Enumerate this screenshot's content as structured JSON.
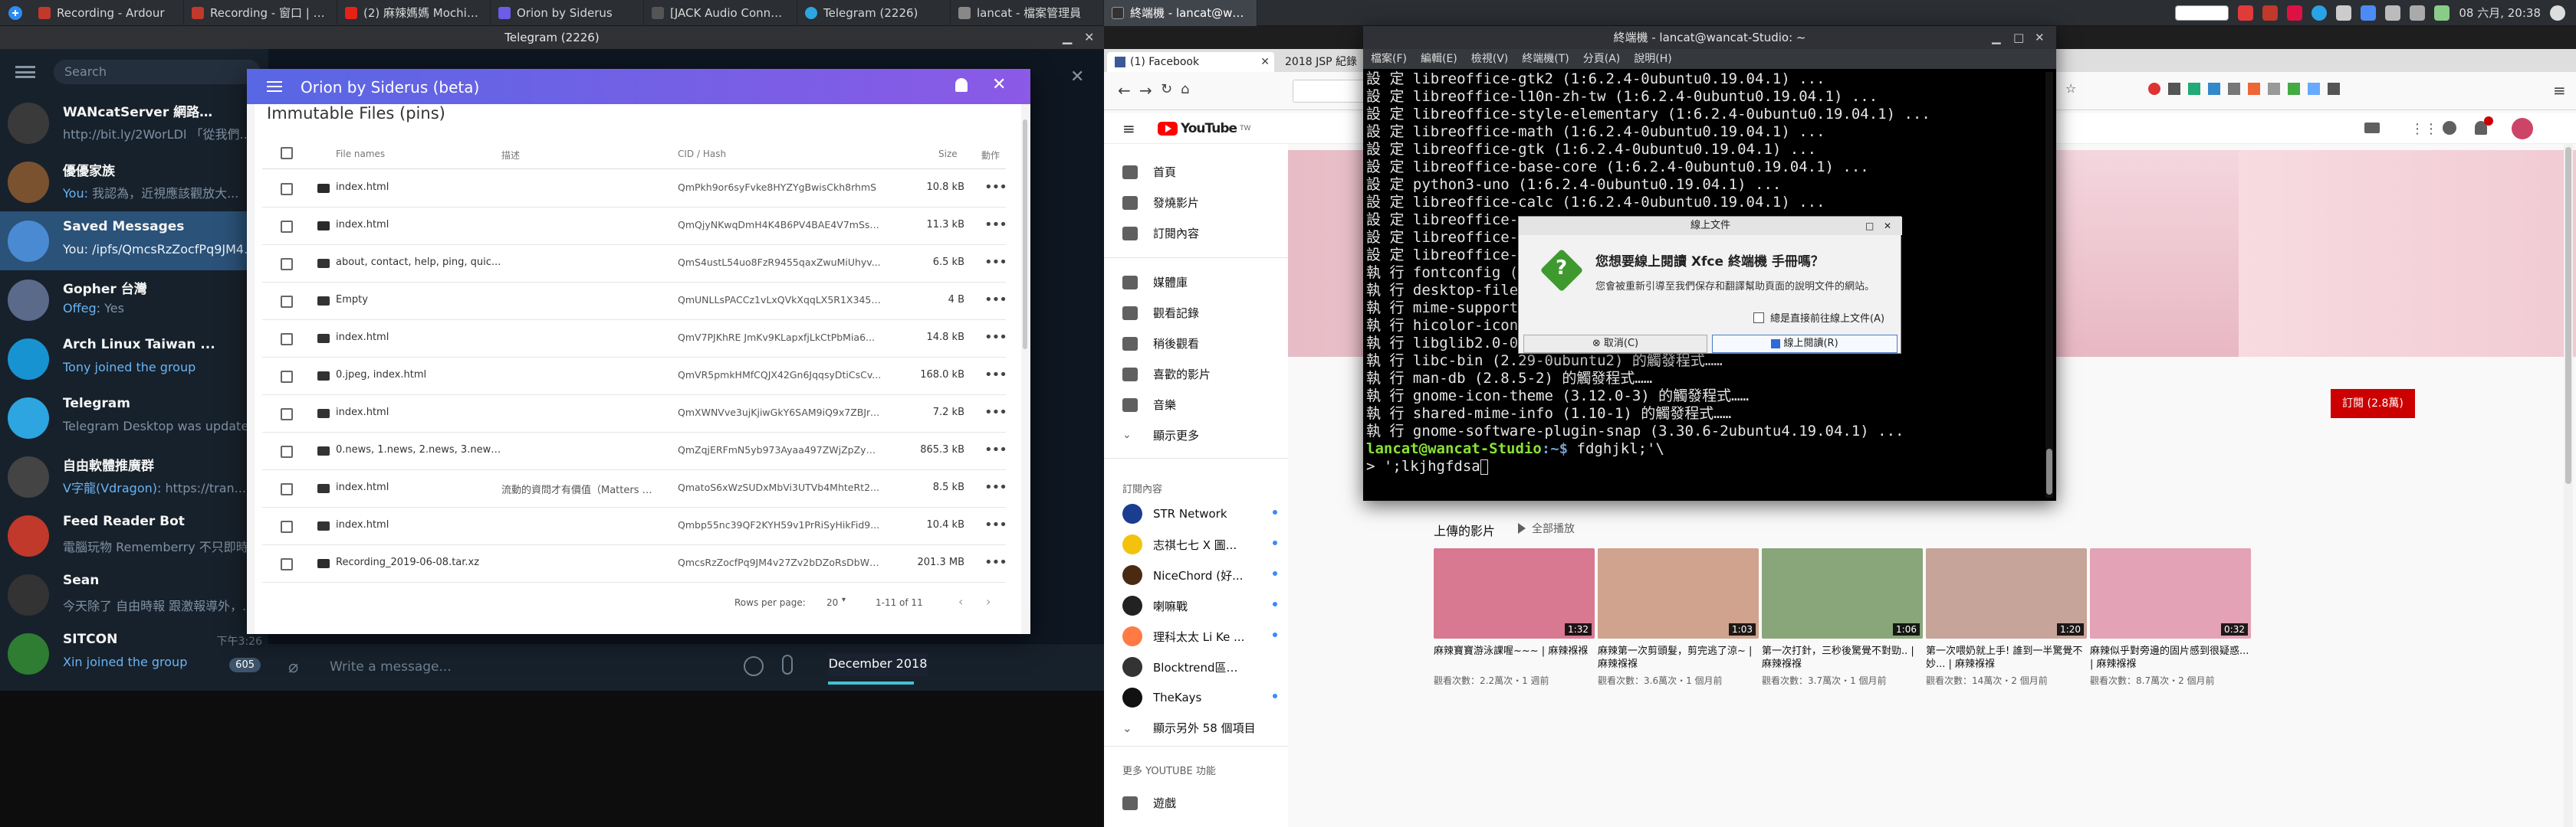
{
  "taskbar": {
    "tasks": [
      {
        "label": "Recording - Ardour",
        "color": "#c0392b"
      },
      {
        "label": "Recording - 窗口 | 混音器 -",
        "color": "#c0392b"
      },
      {
        "label": "(2) 麻辣媽媽 Mochiwawa -",
        "color": "#e62117"
      },
      {
        "label": "Orion by Siderus",
        "color": "#6c5ce7"
      },
      {
        "label": "[JACK Audio Connection Ki...",
        "color": "#555555"
      },
      {
        "label": "Telegram (2226)",
        "color": "#2ca5e0"
      },
      {
        "label": "lancat - 檔案管理員",
        "color": "#888888"
      },
      {
        "label": "終端機 - lancat@wancat-Studio: ~",
        "color": "#333333"
      }
    ],
    "clock": "08 六月, 20:38"
  },
  "telegram": {
    "title": "Telegram (2226)",
    "search_placeholder": "Search",
    "chats": [
      {
        "name": "WANcatServer 網路行...",
        "time": "",
        "who": "",
        "msg": "http://bit.ly/2WorLDl 「從我們...",
        "color": "#3a3a3a"
      },
      {
        "name": "優優家族",
        "time": "",
        "who": "You:",
        "msg": "我認為，近視應該觀放大...",
        "color": "#7a5230"
      },
      {
        "name": "Saved Messages",
        "time": "",
        "who": "You:",
        "msg": "/ipfs/QmcsRzZocfPq9JM4...",
        "color": "#2b5278"
      },
      {
        "name": "Gopher 台灣",
        "time": "",
        "who": "Offeg:",
        "msg": "Yes",
        "color": "#5a6a8a"
      },
      {
        "name": "Arch Linux Taiwan ...",
        "time": "",
        "who": "",
        "msg": "Tony joined the group",
        "color": "#1793d1"
      },
      {
        "name": "Telegram",
        "time": "",
        "who": "",
        "msg": "Telegram Desktop was updated",
        "color": "#2ca5e0"
      },
      {
        "name": "自由軟體推廣群",
        "time": "",
        "who": "V字龍(Vdragon):",
        "msg": "https://tran...",
        "color": "#444444"
      },
      {
        "name": "Feed Reader Bot",
        "time": "",
        "who": "",
        "msg": "電腦玩物 Rememberry 不只即時...",
        "color": "#c0392b"
      },
      {
        "name": "Sean",
        "time": "",
        "who": "",
        "msg": "今天除了 自由時報 跟激報導外，...",
        "color": "#333333"
      },
      {
        "name": "SITCON",
        "time": "下午3:26",
        "who": "",
        "msg": "Xin joined the group",
        "color": "#2e7d32",
        "badge": "605"
      }
    ],
    "input_placeholder": "Write a message...",
    "date_chip": "December 2018"
  },
  "orion": {
    "title": "Orion by Siderus (beta)",
    "section_title": "Immutable Files (pins)",
    "columns": {
      "name": "File names",
      "desc": "描述",
      "cid": "CID / Hash",
      "size": "Size",
      "actions": "動作"
    },
    "rows": [
      {
        "name": "index.html",
        "desc": "",
        "cid": "QmPkh9or6syFvke8HYZYgBwisCkh8rhmS",
        "size": "10.8 kB",
        "folder": false
      },
      {
        "name": "index.html",
        "desc": "",
        "cid": "QmQjyNKwqDmH4K4B6PV4BAE4V7mSsF...",
        "size": "11.3 kB",
        "folder": false
      },
      {
        "name": "about, contact, help, ping, quic...",
        "desc": "",
        "cid": "QmS4ustL54uo8FzR9455qaxZwuMiUhyv...",
        "size": "6.5 kB",
        "folder": true
      },
      {
        "name": "Empty",
        "desc": "",
        "cid": "QmUNLLsPACCz1vLxQVkXqqLX5R1X345q...",
        "size": "4 B",
        "folder": true
      },
      {
        "name": "index.html",
        "desc": "",
        "cid": "QmV7PJKhRE JmKv9KLapxfjLkCtPbMia6...",
        "size": "14.8 kB",
        "folder": true
      },
      {
        "name": "0.jpeg, index.html",
        "desc": "",
        "cid": "QmVR5pmkHMfCQJX42Gn6JqqsyDtiCsCv...",
        "size": "168.0 kB",
        "folder": true
      },
      {
        "name": "index.html",
        "desc": "",
        "cid": "QmXWNVve3ujKjiwGkY6SAM9iQ9x7ZBJrx...",
        "size": "7.2 kB",
        "folder": true
      },
      {
        "name": "0.news, 1.news, 2.news, 3.news...",
        "desc": "",
        "cid": "QmZqjERFmN5yb973Ayaa497ZWjZpZyAr...",
        "size": "865.3 kB",
        "folder": true
      },
      {
        "name": "index.html",
        "desc": "流動的資問才有價值（Matters 如...",
        "cid": "QmatoS6xWzSUDxMbVi3UTVb4MhteRt2...",
        "size": "8.5 kB",
        "folder": true
      },
      {
        "name": "index.html",
        "desc": "",
        "cid": "Qmbp55nc39QF2KYH59v1PrRiSyHikFid9...",
        "size": "10.4 kB",
        "folder": true
      },
      {
        "name": "Recording_2019-06-08.tar.xz",
        "desc": "",
        "cid": "QmcsRzZocfPq9JM4v27Zv2bDZoRsDbWp...",
        "size": "201.3 MB",
        "folder": false
      }
    ],
    "pager": {
      "rows_label": "Rows per page:",
      "rows_value": "20",
      "range": "1-11 of 11"
    }
  },
  "browser": {
    "tabs": [
      {
        "label": "(1) Facebook"
      },
      {
        "label": "2018 JSP 紀錄網..."
      }
    ]
  },
  "youtube": {
    "logo": "YouTube",
    "logo_sup": "TW",
    "nav": [
      {
        "label": "首頁",
        "icon": "home-icon"
      },
      {
        "label": "發燒影片",
        "icon": "fire-icon"
      },
      {
        "label": "訂閱內容",
        "icon": "subscriptions-icon"
      },
      {
        "label": "媒體庫",
        "icon": "library-icon"
      },
      {
        "label": "觀看記錄",
        "icon": "history-icon"
      },
      {
        "label": "稍後觀看",
        "icon": "clock-icon"
      },
      {
        "label": "喜歡的影片",
        "icon": "like-icon"
      },
      {
        "label": "音樂",
        "icon": "music-icon"
      },
      {
        "label": "顯示更多",
        "icon": "chevron-down-icon"
      }
    ],
    "subs_title": "訂閱內容",
    "subs": [
      {
        "label": "STR Network",
        "color": "#1b3d8f"
      },
      {
        "label": "志祺七七 X 圖...",
        "color": "#f4c20d"
      },
      {
        "label": "NiceChord (好...",
        "color": "#4a2a12"
      },
      {
        "label": "喇嘛戰",
        "color": "#222222"
      },
      {
        "label": "理科太太 Li Ke ...",
        "color": "#ff7a45"
      },
      {
        "label": "Blocktrend區塊勢",
        "color": "#333333"
      },
      {
        "label": "TheKays",
        "color": "#111111"
      }
    ],
    "show_more_subs": "顯示另外 58 個項目",
    "more_features": "更多 YOUTUBE 功能",
    "games": "遊戲",
    "subscribe_label": "訂閱 (2.8萬)",
    "uploads_title": "上傳的影片",
    "play_all": "全部播放",
    "videos": [
      {
        "title": "麻辣寶寶游泳課喔~~~ | 麻辣褓褓",
        "meta": "觀看次數：2.2萬次・1 週前",
        "duration": "1:32",
        "color": "#d97891"
      },
      {
        "title": "麻辣第一次剪頭髮，剪完逃了涼~ | 麻辣褓褓",
        "meta": "觀看次數：3.6萬次・1 個月前",
        "duration": "1:03",
        "color": "#cfa38e"
      },
      {
        "title": "第一次打針，三秒後驚覺不對勁.. | 麻辣褓褓",
        "meta": "觀看次數：3.7萬次・1 個月前",
        "duration": "1:06",
        "color": "#89a67a"
      },
      {
        "title": "第一次喂奶就上手! 誰到一半驚覺不妙... | 麻辣褓褓",
        "meta": "觀看次數：14萬次・2 個月前",
        "duration": "1:20",
        "color": "#c6a49a"
      },
      {
        "title": "麻辣似乎對旁邊的固片感到很疑惑... | 麻辣褓褓",
        "meta": "觀看次數：8.7萬次・2 個月前",
        "duration": "0:32",
        "color": "#e3a2b5"
      }
    ]
  },
  "terminal": {
    "title": "終端機 - lancat@wancat-Studio: ~",
    "menu": [
      "檔案(F)",
      "編輯(E)",
      "檢視(V)",
      "終端機(T)",
      "分頁(A)",
      "說明(H)"
    ],
    "lines": [
      "設 定 libreoffice-gtk2 (1:6.2.4-0ubuntu0.19.04.1) ...",
      "設 定 libreoffice-l10n-zh-tw (1:6.2.4-0ubuntu0.19.04.1) ...",
      "設 定 libreoffice-style-elementary (1:6.2.4-0ubuntu0.19.04.1) ...",
      "設 定 libreoffice-math (1:6.2.4-0ubuntu0.19.04.1) ...",
      "設 定 libreoffice-gtk (1:6.2.4-0ubuntu0.19.04.1) ...",
      "設 定 libreoffice-base-core (1:6.2.4-0ubuntu0.19.04.1) ...",
      "設 定 python3-uno (1:6.2.4-0ubuntu0.19.04.1) ...",
      "設 定 libreoffice-calc (1:6.2.4-0ubuntu0.19.04.1) ...",
      "設 定 libreoffice-w",
      "設 定 libreoffice-h",
      "設 定 libreoffice-h",
      "執 行 fontconfig (2",
      "執 行 desktop-file-",
      "執 行 mime-support",
      "執 行 hicolor-icon-",
      "執 行 libglib2.0-0:",
      "執 行 libc-bin (2.29-0ubuntu2) 的觸發程式……",
      "執 行 man-db (2.8.5-2) 的觸發程式……",
      "執 行 gnome-icon-theme (3.12.0-3) 的觸發程式……",
      "執 行 shared-mime-info (1.10-1) 的觸發程式……",
      "執 行 gnome-software-plugin-snap (3.30.6-2ubuntu4.19.04.1) ..."
    ],
    "prompt_user": "lancat@wancat-Studio",
    "prompt_path": ":~$ ",
    "prompt_cmd": "fdghjkl;'\\",
    "cont_line": "> ';lkjhgfdsa"
  },
  "dialog": {
    "title": "線上文件",
    "heading": "您想要線上閱讀 Xfce 終端機 手冊嗎？",
    "text": "您會被重新引導至我們保存和翻譯幫助頁面的說明文件的網站。",
    "checkbox": "總是直接前往線上文件(A)",
    "cancel": "取消(C)",
    "ok": "線上閱讀(R)"
  }
}
